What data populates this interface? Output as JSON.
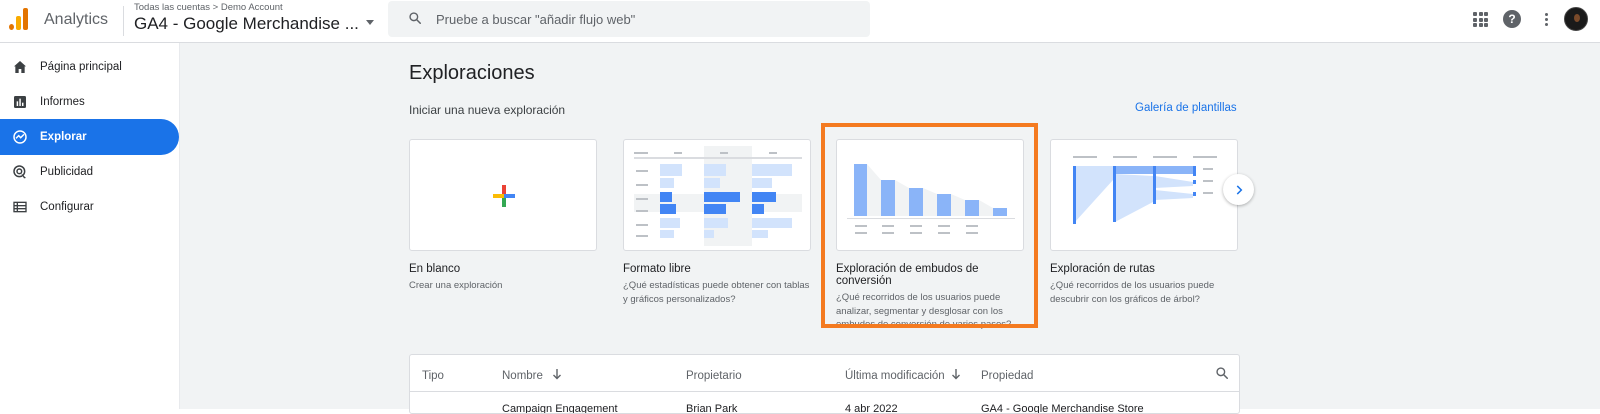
{
  "header": {
    "app_name": "Analytics",
    "breadcrumb": "Todas las cuentas > Demo Account",
    "property_title": "GA4 - Google Merchandise ...",
    "search_placeholder": "Pruebe a buscar \"añadir flujo web\""
  },
  "sidebar": {
    "items": [
      {
        "label": "Página principal",
        "icon": "home-icon",
        "active": false
      },
      {
        "label": "Informes",
        "icon": "reports-icon",
        "active": false
      },
      {
        "label": "Explorar",
        "icon": "explore-icon",
        "active": true
      },
      {
        "label": "Publicidad",
        "icon": "advertising-icon",
        "active": false
      },
      {
        "label": "Configurar",
        "icon": "configure-icon",
        "active": false
      }
    ]
  },
  "main": {
    "title": "Exploraciones",
    "section_label": "Iniciar una nueva exploración",
    "gallery_link": "Galería de plantillas",
    "cards": [
      {
        "title": "En blanco",
        "desc": "Crear una exploración"
      },
      {
        "title": "Formato libre",
        "desc": "¿Qué estadísticas puede obtener con tablas y gráficos personalizados?"
      },
      {
        "title": "Exploración de embudos de conversión",
        "desc": "¿Qué recorridos de los usuarios puede analizar, segmentar y desglosar con los embudos de conversión de varios pasos?"
      },
      {
        "title": "Exploración de rutas",
        "desc": "¿Qué recorridos de los usuarios puede descubrir con los gráficos de árbol?"
      }
    ]
  },
  "table": {
    "headers": [
      "Tipo",
      "Nombre",
      "Propietario",
      "Última modificación",
      "Propiedad"
    ],
    "first_row": [
      "Campaign Engagement",
      "Brian Park",
      "4 abr 2022",
      "GA4 - Google Merchandise Store"
    ]
  },
  "colors": {
    "accent": "#1a73e8",
    "highlight": "#f47a20",
    "background": "#f1f3f4"
  }
}
